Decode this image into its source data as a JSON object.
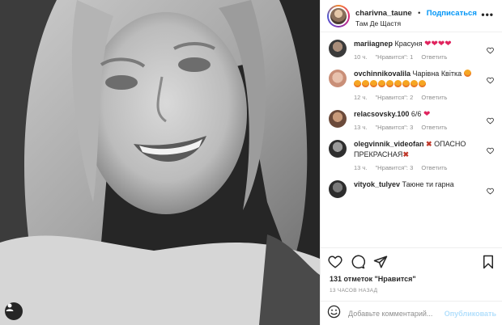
{
  "post": {
    "username": "charivna_taune",
    "follow_label": "Подписаться",
    "location": "Там Де Щастя",
    "more_label": "•••"
  },
  "comments": [
    {
      "user": "mariiagnep",
      "text": "Красуня",
      "emojis": "❤❤❤❤",
      "time": "10 ч.",
      "likes": "\"Нравится\": 1",
      "reply": "Ответить",
      "avatar_color": "#3a3a3a"
    },
    {
      "user": "ovchinnikovalila",
      "text": "Чарівна Квітка",
      "emoji_count": 10,
      "time": "12 ч.",
      "likes": "\"Нравится\": 2",
      "reply": "Ответить",
      "avatar_color": "#d8a58e"
    },
    {
      "user": "relacsovsky.100",
      "text": "6/6",
      "emojis": "❤",
      "time": "13 ч.",
      "likes": "\"Нравится\": 3",
      "reply": "Ответить",
      "avatar_color": "#6b4a3a"
    },
    {
      "user": "olegvinnik_videofan",
      "text_before": "✖",
      "text": "ОПАСНО ПРЕКРАСНАЯ",
      "text_after": "✖",
      "time": "13 ч.",
      "likes": "\"Нравится\": 3",
      "reply": "Ответить",
      "avatar_color": "#4a4a4a"
    },
    {
      "user": "vityok_tulyev",
      "text": "Таюне ти гарна",
      "avatar_color": "#2d2d2d"
    }
  ],
  "likes_text": "131 отметок \"Нравится\"",
  "time_ago": "13 ЧАСОВ НАЗАД",
  "add_comment": {
    "placeholder": "Добавьте комментарий...",
    "post_label": "Опубликовать"
  },
  "icons": [
    "heart-icon",
    "comment-icon",
    "share-icon",
    "bookmark-icon",
    "emoji-icon",
    "user-tag-icon",
    "more-icon"
  ]
}
